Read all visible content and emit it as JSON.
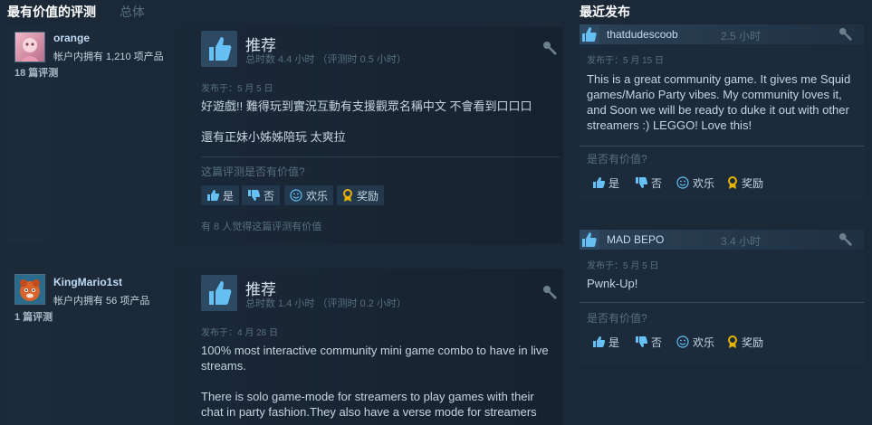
{
  "headers": {
    "most_helpful": "最有价值的评测",
    "overall": "总体",
    "recent": "最近发布"
  },
  "reviews": [
    {
      "name": "orange",
      "owned": "帐户内拥有 1,210 项产品",
      "review_count": "18 篇评测",
      "recommend": "推荐",
      "hours": "总时数 4.4 小时  （评测时 0.5 小时）",
      "posted": "发布于：5 月 5 日",
      "lines": [
        "好遊戲!! 難得玩到實況互動有支援觀眾名稱中文 不會看到口口口",
        "還有正妹小姊姊陪玩 太爽拉"
      ],
      "question": "这篇评测是否有价值?",
      "yes": "是",
      "no": "否",
      "funny": "欢乐",
      "award": "奖励",
      "helpful": "有 8 人觉得这篇评测有价值"
    },
    {
      "name": "KingMario1st",
      "owned": "帐户内拥有 56 项产品",
      "review_count": "1 篇评测",
      "recommend": "推荐",
      "hours": "总时数 1.4 小时  （评测时 0.2 小时）",
      "posted": "发布于：4 月 28 日",
      "lines": [
        "100% most interactive community mini game combo to have in live streams.",
        "There is solo game-mode for streamers to play games with their chat in party fashion.They also have a verse mode for streamers"
      ]
    }
  ],
  "recent": [
    {
      "name": "thatdudescoob",
      "hours": "2.5 小时",
      "posted": "发布于：5 月 15 日",
      "text": "This is a great community game. It gives me Squid games/Mario Party vibes. My community loves it, and Soon we will be ready to duke it out with other streamers :) LEGGO! Love this!",
      "question": "是否有价值?",
      "yes": "是",
      "no": "否",
      "funny": "欢乐",
      "award": "奖励"
    },
    {
      "name": "MAD BEPO",
      "hours": "3.4 小时",
      "posted": "发布于：5 月 5 日",
      "text": "Pwnk-Up!",
      "question": "是否有价值?",
      "yes": "是",
      "no": "否",
      "funny": "欢乐",
      "award": "奖励"
    }
  ],
  "colors": {
    "bg": "#1b2838",
    "accent": "#66c0f4",
    "award": "#e8b200"
  }
}
